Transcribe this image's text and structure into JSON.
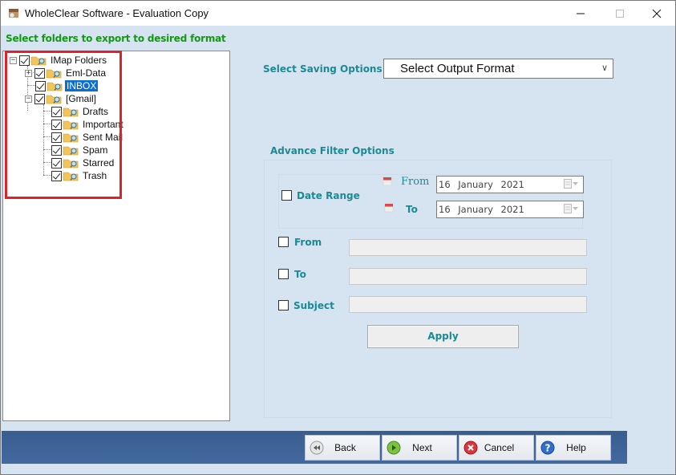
{
  "window": {
    "title": "WholeClear Software - Evaluation Copy",
    "controls": {
      "minimize": "minimize",
      "maximize": "maximize",
      "close": "close"
    }
  },
  "heading": "Select folders to export to desired format",
  "tree": {
    "nodes": [
      {
        "label": "IMap Folders",
        "checked": true,
        "expander": "-",
        "level": 0
      },
      {
        "label": "Eml-Data",
        "checked": true,
        "expander": "+",
        "level": 1
      },
      {
        "label": "INBOX",
        "checked": true,
        "expander": null,
        "level": 1,
        "selected": true
      },
      {
        "label": "[Gmail]",
        "checked": true,
        "expander": "-",
        "level": 1
      },
      {
        "label": "Drafts",
        "checked": true,
        "expander": null,
        "level": 2
      },
      {
        "label": "Important",
        "checked": true,
        "expander": null,
        "level": 2
      },
      {
        "label": "Sent Mail",
        "checked": true,
        "expander": null,
        "level": 2
      },
      {
        "label": "Spam",
        "checked": true,
        "expander": null,
        "level": 2
      },
      {
        "label": "Starred",
        "checked": true,
        "expander": null,
        "level": 2
      },
      {
        "label": "Trash",
        "checked": true,
        "expander": null,
        "level": 2
      }
    ],
    "highlight_color": "#e0202a"
  },
  "saving": {
    "label": "Select Saving Options",
    "select_value": "Select Output Format"
  },
  "filter": {
    "title": "Advance Filter Options",
    "date_range": {
      "label": "Date Range",
      "checked": false,
      "from_label": "From",
      "to_label": "To",
      "from_value": "16  January  2021",
      "to_value": "16  January  2021"
    },
    "from": {
      "label": "From",
      "checked": false,
      "value": ""
    },
    "to": {
      "label": "To",
      "checked": false,
      "value": ""
    },
    "subject": {
      "label": "Subject",
      "checked": false,
      "value": ""
    },
    "apply_label": "Apply"
  },
  "footer": {
    "back": "Back",
    "next": "Next",
    "cancel": "Cancel",
    "help": "Help"
  },
  "colors": {
    "heading_green": "#119a11",
    "label_teal": "#1a8a94",
    "bar_blue": "#3e6397",
    "background": "#d6e4f1"
  }
}
